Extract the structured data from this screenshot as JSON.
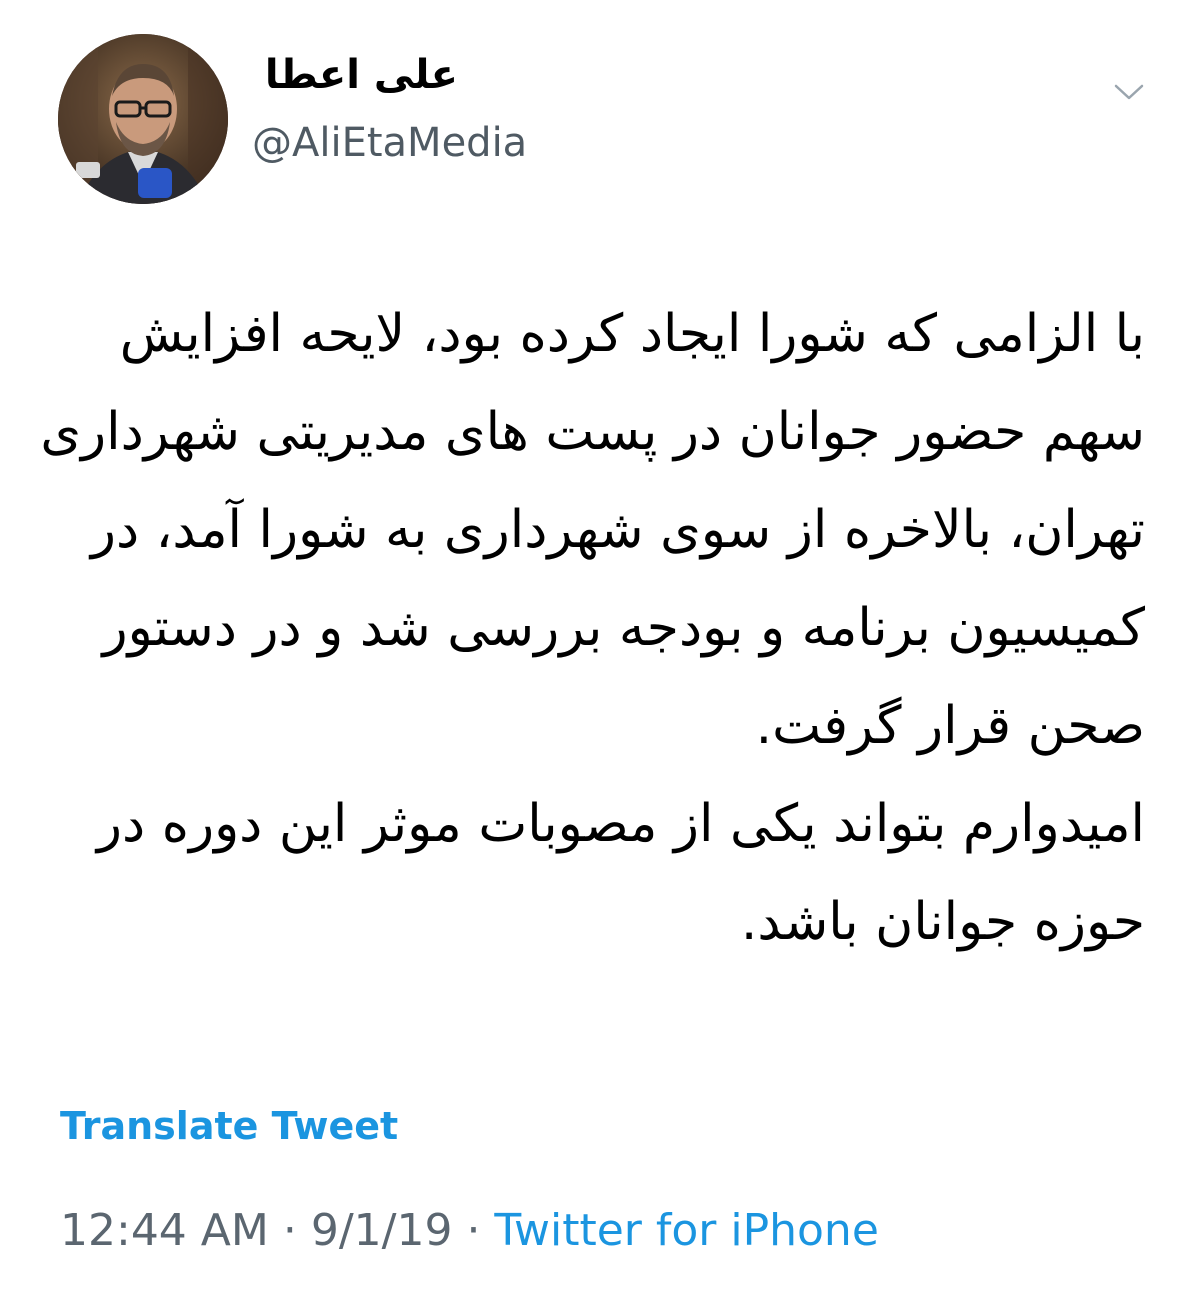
{
  "author": {
    "display_name": "علی اعطا",
    "handle": "@AliEtaMedia"
  },
  "tweet": {
    "paragraph_1": "با الزامی که شورا ایجاد کرده بود، لایحه افزایش سهم حضور جوانان در پست های مدیریتی شهرداری تهران، بالاخره از سوی شهرداری به شورا آمد، در کمیسیون برنامه و بودجه بررسی شد و در دستور صحن قرار گرفت.",
    "paragraph_2": "امیدوارم بتواند یکی از مصوبات موثر این دوره در حوزه جوانان باشد."
  },
  "actions": {
    "translate_label": "Translate Tweet",
    "more_icon": "chevron-down-icon"
  },
  "meta": {
    "time": "12:44 AM",
    "separator": " · ",
    "date": "9/1/19",
    "source": "Twitter for iPhone"
  },
  "colors": {
    "link": "#1b95e0",
    "secondary_text": "#5b6670",
    "text": "#000000"
  }
}
